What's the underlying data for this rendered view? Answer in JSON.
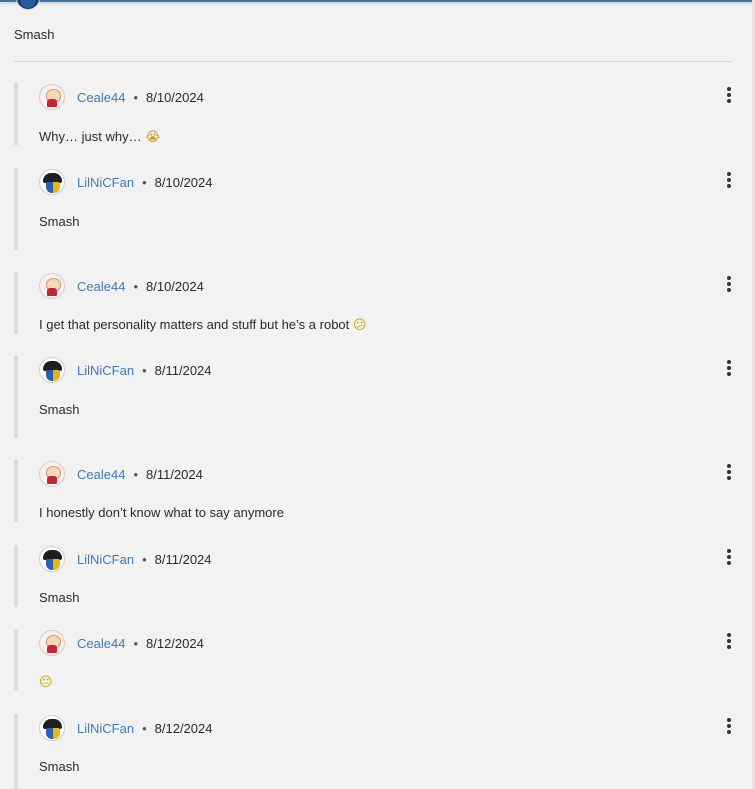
{
  "parent": {
    "text": "Smash"
  },
  "comments": [
    {
      "user": "Ceale44",
      "avatar": "ceale-avatar",
      "date": "8/10/2024",
      "body": "Why… just why…",
      "emoji": "😭"
    },
    {
      "user": "LilNiCFan",
      "avatar": "lilnicfan-avatar",
      "date": "8/10/2024",
      "body": "Smash",
      "emoji": ""
    },
    {
      "user": "Ceale44",
      "avatar": "ceale-avatar",
      "date": "8/10/2024",
      "body": "I get that personality matters and stuff but he’s a robot",
      "emoji": "😕"
    },
    {
      "user": "LilNiCFan",
      "avatar": "lilnicfan-avatar",
      "date": "8/11/2024",
      "body": "Smash",
      "emoji": ""
    },
    {
      "user": "Ceale44",
      "avatar": "ceale-avatar",
      "date": "8/11/2024",
      "body": "I honestly don’t know what to say anymore",
      "emoji": ""
    },
    {
      "user": "LilNiCFan",
      "avatar": "lilnicfan-avatar",
      "date": "8/11/2024",
      "body": "Smash",
      "emoji": ""
    },
    {
      "user": "Ceale44",
      "avatar": "ceale-avatar",
      "date": "8/12/2024",
      "body": "",
      "emoji": "😐"
    },
    {
      "user": "LilNiCFan",
      "avatar": "lilnicfan-avatar",
      "date": "8/12/2024",
      "body": "Smash",
      "emoji": ""
    }
  ],
  "labels": {
    "separator": "•"
  },
  "icons": {
    "menu": "kebab-menu-icon"
  },
  "colors": {
    "username": "#3d7cb5",
    "thread_bar": "#dcdcdc",
    "background": "#f2f2f2"
  }
}
